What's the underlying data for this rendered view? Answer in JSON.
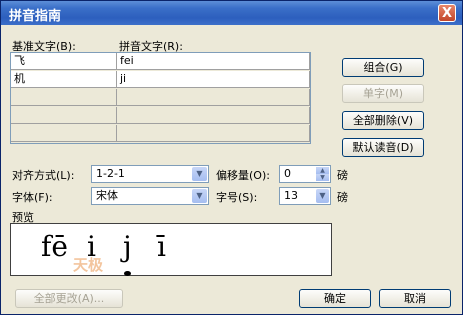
{
  "window": {
    "title": "拼音指南",
    "close_symbol": "X"
  },
  "columns": {
    "base": "基准文字(B):",
    "pinyin": "拼音文字(R):"
  },
  "rows": [
    {
      "base": "飞",
      "pinyin": "fei"
    },
    {
      "base": "机",
      "pinyin": "ji"
    },
    {
      "base": "",
      "pinyin": ""
    },
    {
      "base": "",
      "pinyin": ""
    },
    {
      "base": "",
      "pinyin": ""
    }
  ],
  "buttons": {
    "group": "组合(G)",
    "single": "单字(M)",
    "delete_all": "全部删除(V)",
    "default_reading": "默认读音(D)",
    "change_all": "全部更改(A)...",
    "ok": "确定",
    "cancel": "取消"
  },
  "alignment": {
    "label": "对齐方式(L):",
    "value": "1-2-1"
  },
  "offset": {
    "label": "偏移量(O):",
    "value": "0",
    "unit": "磅"
  },
  "font": {
    "label": "字体(F):",
    "value": "宋体"
  },
  "size": {
    "label": "字号(S):",
    "value": "13",
    "unit": "磅"
  },
  "preview": {
    "label": "预览",
    "syllables": [
      "fē",
      "i",
      "j",
      "ī"
    ],
    "watermark": "天极"
  },
  "colors": {
    "titlebar": "#2d5fbe",
    "dialog": "#ece9d8"
  },
  "icons": [
    "close-icon",
    "dropdown-arrow-icon",
    "spin-up-icon",
    "spin-down-icon"
  ]
}
